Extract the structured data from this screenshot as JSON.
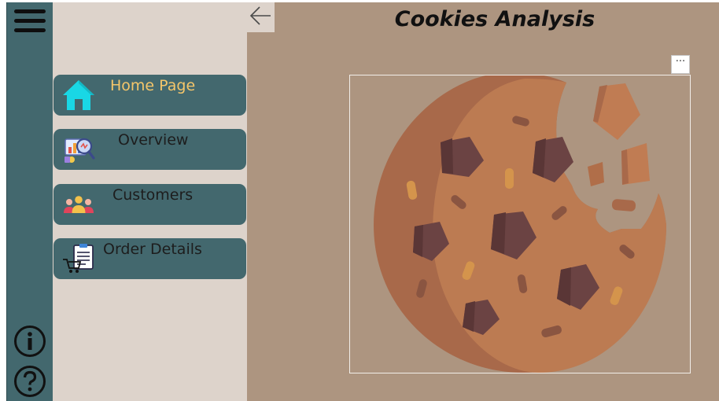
{
  "title": "Cookies Analysis",
  "nav": {
    "items": [
      {
        "label": "Home Page",
        "icon": "home-icon",
        "active": true
      },
      {
        "label": "Overview",
        "icon": "analytics-icon",
        "active": false
      },
      {
        "label": "Customers",
        "icon": "customers-icon",
        "active": false
      },
      {
        "label": "Order Details",
        "icon": "order-details-icon",
        "active": false
      }
    ]
  },
  "rail": {
    "icons": [
      "hamburger-menu-icon",
      "info-icon",
      "help-icon"
    ]
  },
  "toolbar": {
    "back_icon": "back-arrow-icon",
    "more_label": "···"
  },
  "visual": {
    "image": "cookie-image"
  },
  "colors": {
    "rail": "#43686e",
    "menu_panel": "#ddd3cb",
    "canvas": "#ad9580",
    "active_label": "#f5c66a"
  }
}
